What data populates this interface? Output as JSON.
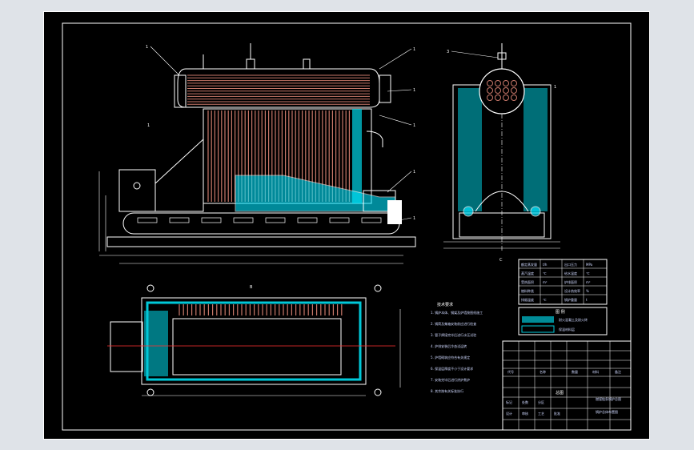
{
  "app": {
    "background_color": "#dfe3e8",
    "sheet_color": "#000000"
  },
  "colors": {
    "frame": "#ffffff",
    "outline": "#ffffff",
    "tubes": "#c8786a",
    "refractory": "#00c8d8",
    "water": "#00e5ff",
    "centerline": "#ff3030",
    "dimension": "#ffffff",
    "leader": "#ffffff",
    "grate": "#ffffff"
  },
  "labels": {
    "main_view_callouts": [
      "1",
      "1",
      "1",
      "1",
      "1",
      "1",
      "1"
    ],
    "side_view_callouts": [
      "3",
      "1"
    ],
    "section_title": "B",
    "center_mark": "C"
  },
  "notes": {
    "title": "技术要求",
    "lines": [
      "1. 锅炉本体、钢架及炉墙按图纸施工",
      "2. 锅筒及集箱安装前应进行检查",
      "3. 管子焊接完毕后进行水压试验",
      "4. 炉排安装后冷态试运转",
      "5. 炉墙砌筑应符合有关规定",
      "6. 保温层厚度不小于设计要求",
      "7. 安装完毕后进行烘炉煮炉",
      "8. 其余按有关标准执行"
    ]
  },
  "specs_table": {
    "rows": [
      [
        "额定蒸发量",
        "t/h",
        "出口压力",
        "MPa"
      ],
      [
        "蒸汽温度",
        "℃",
        "给水温度",
        "℃"
      ],
      [
        "受热面积",
        "m²",
        "炉排面积",
        "m²"
      ],
      [
        "燃料种类",
        "",
        "设计热效率",
        "%"
      ],
      [
        "排烟温度",
        "℃",
        "锅炉重量",
        "t"
      ]
    ]
  },
  "legend": {
    "title": "图 例",
    "items": [
      "耐火混凝土及耐火砖",
      "保温材料层"
    ]
  },
  "title_block": {
    "drawing_title": "总图",
    "project": "燃煤链条锅炉总图",
    "sub": "锅炉总体布置图",
    "cells": [
      "标记",
      "处数",
      "分区",
      "设计",
      "审核",
      "工艺",
      "批准"
    ],
    "parts": [
      "代号",
      "名称",
      "数量",
      "材料",
      "备注"
    ]
  }
}
